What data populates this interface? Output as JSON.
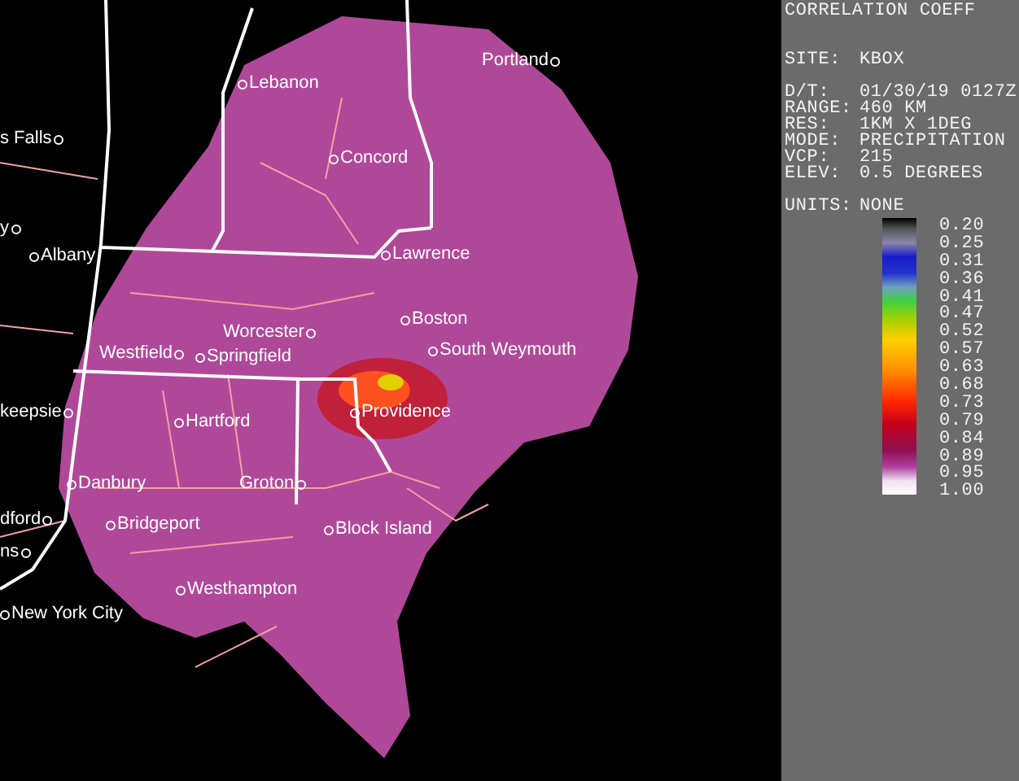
{
  "map": {
    "cities": [
      {
        "name": "Portland",
        "kind": "marker-after"
      },
      {
        "name": "Lebanon",
        "kind": "marker-before"
      },
      {
        "name": "s Falls",
        "kind": "marker-after"
      },
      {
        "name": "Concord",
        "kind": "marker-before"
      },
      {
        "name": "y",
        "kind": "marker-after"
      },
      {
        "name": "Albany",
        "kind": "marker-before"
      },
      {
        "name": "Lawrence",
        "kind": "marker-before"
      },
      {
        "name": "Boston",
        "kind": "marker-before"
      },
      {
        "name": "Worcester",
        "kind": "marker-after"
      },
      {
        "name": "Westfield",
        "kind": "marker-after"
      },
      {
        "name": "Springfield",
        "kind": "marker-before"
      },
      {
        "name": "South Weymouth",
        "kind": "marker-before"
      },
      {
        "name": "keepsie",
        "kind": "marker-after"
      },
      {
        "name": "Hartford",
        "kind": "marker-before"
      },
      {
        "name": "Providence",
        "kind": "marker-before"
      },
      {
        "name": "Danbury",
        "kind": "marker-before"
      },
      {
        "name": "Groton",
        "kind": "marker-after"
      },
      {
        "name": "dford",
        "kind": "marker-after"
      },
      {
        "name": "Bridgeport",
        "kind": "marker-before"
      },
      {
        "name": "Block Island",
        "kind": "marker-before"
      },
      {
        "name": "ns",
        "kind": "marker-after"
      },
      {
        "name": "Westhampton",
        "kind": "marker-before"
      },
      {
        "name": "New York City",
        "kind": "marker-before"
      }
    ]
  },
  "panel": {
    "title": "CORRELATION COEFF",
    "site": {
      "label": "SITE:",
      "value": "KBOX"
    },
    "details": [
      {
        "label": "D/T:",
        "value": "01/30/19 0127Z"
      },
      {
        "label": "RANGE:",
        "value": "460 KM"
      },
      {
        "label": "RES:",
        "value": "1KM X 1DEG"
      },
      {
        "label": "MODE:",
        "value": "PRECIPITATION"
      },
      {
        "label": "VCP:",
        "value": "215"
      },
      {
        "label": "ELEV:",
        "value": "0.5 DEGREES"
      }
    ],
    "units": {
      "label": "UNITS:",
      "value": "NONE"
    },
    "legend": {
      "labels": [
        "0.20",
        "0.25",
        "0.31",
        "0.36",
        "0.41",
        "0.47",
        "0.52",
        "0.57",
        "0.63",
        "0.68",
        "0.73",
        "0.79",
        "0.84",
        "0.89",
        "0.95",
        "1.00"
      ]
    }
  }
}
